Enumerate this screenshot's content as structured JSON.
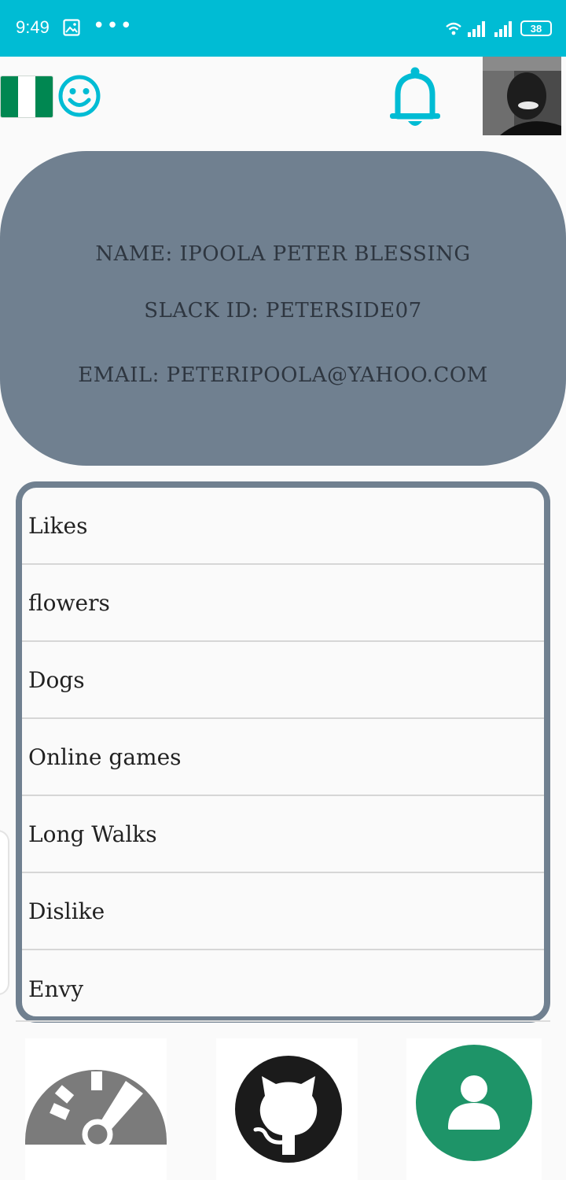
{
  "status_bar": {
    "time": "9:49",
    "battery": "38"
  },
  "profile": {
    "name": "NAME: IPOOLA PETER BLESSING",
    "slack_id": "SLACK ID: PETERSIDE07",
    "email": "EMAIL: PETERIPOOLA@YAHOO.COM"
  },
  "list": {
    "items": [
      {
        "label": "Likes"
      },
      {
        "label": "flowers"
      },
      {
        "label": "Dogs"
      },
      {
        "label": "Online games"
      },
      {
        "label": "Long Walks"
      },
      {
        "label": "Dislike"
      },
      {
        "label": "Envy"
      }
    ]
  },
  "colors": {
    "status_bar": "#00bcd4",
    "accent": "#00bcd4",
    "card": "#708090",
    "flag_green": "#008751",
    "person_green": "#1e9468"
  },
  "icons": [
    "gallery-icon",
    "more-dots-icon",
    "wifi-icon",
    "signal-icon",
    "battery-icon",
    "nigeria-flag-icon",
    "smiley-icon",
    "bell-icon",
    "dashboard-icon",
    "github-icon",
    "person-icon"
  ]
}
